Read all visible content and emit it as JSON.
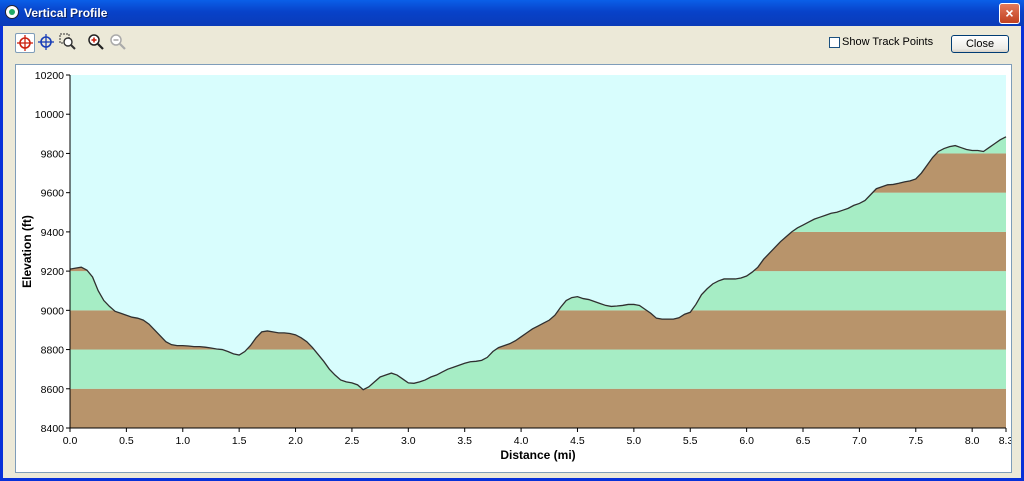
{
  "window": {
    "title": "Vertical Profile",
    "close_glyph": "×"
  },
  "toolbar": {
    "tools": [
      {
        "icon": "crosshair-select-icon"
      },
      {
        "icon": "crosshair-move-icon"
      },
      {
        "icon": "zoom-box-icon"
      },
      {
        "icon": "zoom-in-icon"
      },
      {
        "icon": "zoom-out-icon"
      }
    ],
    "show_track_points_label": "Show Track Points",
    "show_track_points_checked": false,
    "close_label": "Close"
  },
  "colors": {
    "sky": "#d8fdfd",
    "band_green": "#a6edc5",
    "band_brown": "#b8946b",
    "line": "#2f2f2f"
  },
  "chart_data": {
    "type": "area",
    "xlabel": "Distance   (mi)",
    "ylabel": "Elevation (ft)",
    "xlim": [
      0,
      8.3
    ],
    "ylim": [
      8400,
      10200
    ],
    "x_ticks": [
      "0.0",
      "0.5",
      "1.0",
      "1.5",
      "2.0",
      "2.5",
      "3.0",
      "3.5",
      "4.0",
      "4.5",
      "5.0",
      "5.5",
      "6.0",
      "6.5",
      "7.0",
      "7.5",
      "8.0",
      "8.3"
    ],
    "y_ticks": [
      "8400",
      "8600",
      "8800",
      "9000",
      "9200",
      "9400",
      "9600",
      "9800",
      "10000",
      "10200"
    ],
    "grid": false,
    "x": [
      0.0,
      0.05,
      0.1,
      0.15,
      0.2,
      0.25,
      0.3,
      0.35,
      0.4,
      0.45,
      0.5,
      0.55,
      0.6,
      0.65,
      0.7,
      0.75,
      0.8,
      0.85,
      0.9,
      0.95,
      1.0,
      1.05,
      1.1,
      1.15,
      1.2,
      1.25,
      1.3,
      1.35,
      1.4,
      1.45,
      1.5,
      1.55,
      1.6,
      1.65,
      1.7,
      1.75,
      1.8,
      1.85,
      1.9,
      1.95,
      2.0,
      2.05,
      2.1,
      2.15,
      2.2,
      2.25,
      2.3,
      2.35,
      2.4,
      2.45,
      2.5,
      2.55,
      2.6,
      2.65,
      2.7,
      2.75,
      2.8,
      2.85,
      2.9,
      2.95,
      3.0,
      3.05,
      3.1,
      3.15,
      3.2,
      3.25,
      3.3,
      3.35,
      3.4,
      3.45,
      3.5,
      3.55,
      3.6,
      3.65,
      3.7,
      3.75,
      3.8,
      3.85,
      3.9,
      3.95,
      4.0,
      4.05,
      4.1,
      4.15,
      4.2,
      4.25,
      4.3,
      4.35,
      4.4,
      4.45,
      4.5,
      4.55,
      4.6,
      4.65,
      4.7,
      4.75,
      4.8,
      4.85,
      4.9,
      4.95,
      5.0,
      5.05,
      5.1,
      5.15,
      5.2,
      5.25,
      5.3,
      5.35,
      5.4,
      5.45,
      5.5,
      5.55,
      5.6,
      5.65,
      5.7,
      5.75,
      5.8,
      5.85,
      5.9,
      5.95,
      6.0,
      6.05,
      6.1,
      6.15,
      6.2,
      6.25,
      6.3,
      6.35,
      6.4,
      6.45,
      6.5,
      6.55,
      6.6,
      6.65,
      6.7,
      6.75,
      6.8,
      6.85,
      6.9,
      6.95,
      7.0,
      7.05,
      7.1,
      7.15,
      7.2,
      7.25,
      7.3,
      7.35,
      7.4,
      7.45,
      7.5,
      7.55,
      7.6,
      7.65,
      7.7,
      7.75,
      7.8,
      7.85,
      7.9,
      7.95,
      8.0,
      8.05,
      8.1,
      8.15,
      8.2,
      8.25,
      8.3
    ],
    "series": [
      {
        "values": [
          9210,
          9215,
          9220,
          9205,
          9170,
          9100,
          9050,
          9020,
          8995,
          8985,
          8975,
          8965,
          8960,
          8950,
          8930,
          8900,
          8870,
          8840,
          8825,
          8820,
          8820,
          8818,
          8815,
          8815,
          8812,
          8808,
          8803,
          8800,
          8790,
          8778,
          8772,
          8790,
          8820,
          8860,
          8890,
          8895,
          8890,
          8885,
          8885,
          8882,
          8875,
          8860,
          8840,
          8810,
          8775,
          8740,
          8700,
          8670,
          8645,
          8635,
          8630,
          8620,
          8595,
          8610,
          8635,
          8660,
          8670,
          8680,
          8670,
          8650,
          8630,
          8628,
          8635,
          8645,
          8660,
          8670,
          8685,
          8700,
          8710,
          8720,
          8730,
          8738,
          8740,
          8745,
          8760,
          8790,
          8810,
          8820,
          8830,
          8845,
          8865,
          8885,
          8905,
          8920,
          8935,
          8950,
          8975,
          9015,
          9050,
          9065,
          9070,
          9060,
          9055,
          9045,
          9035,
          9025,
          9020,
          9022,
          9025,
          9030,
          9030,
          9025,
          9005,
          8985,
          8960,
          8955,
          8955,
          8955,
          8962,
          8980,
          8990,
          9030,
          9080,
          9110,
          9135,
          9150,
          9160,
          9160,
          9160,
          9165,
          9175,
          9195,
          9220,
          9260,
          9290,
          9320,
          9350,
          9375,
          9400,
          9420,
          9435,
          9450,
          9465,
          9475,
          9485,
          9495,
          9500,
          9510,
          9520,
          9535,
          9545,
          9560,
          9590,
          9620,
          9630,
          9640,
          9642,
          9648,
          9655,
          9660,
          9670,
          9700,
          9740,
          9780,
          9810,
          9825,
          9835,
          9840,
          9830,
          9820,
          9815,
          9815,
          9810,
          9830,
          9850,
          9870,
          9885
        ]
      }
    ]
  }
}
